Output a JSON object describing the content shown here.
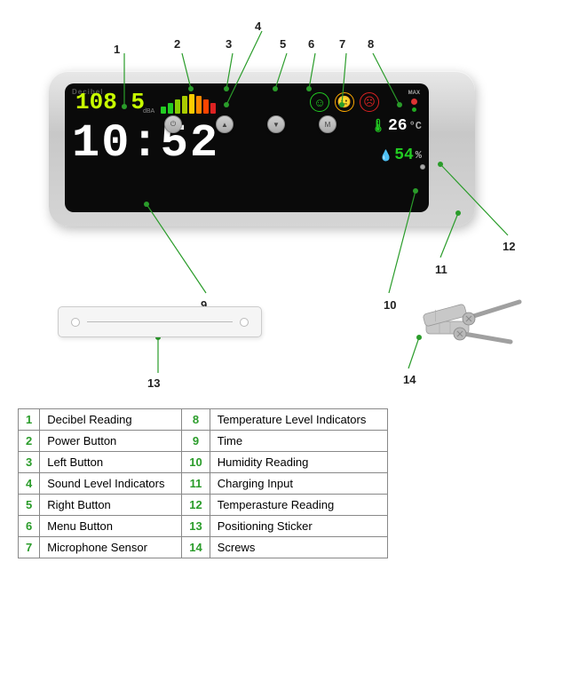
{
  "diagram": {
    "device": {
      "brand": "Decibel",
      "db_value": "108.5",
      "dba_label": "dBA",
      "time_value": "10:52",
      "temp_value": "26",
      "temp_unit": "°C",
      "humidity_value": "54",
      "humidity_unit": "%"
    },
    "callouts": [
      {
        "num": "1",
        "label": "Decibel Reading"
      },
      {
        "num": "2",
        "label": "Power Button"
      },
      {
        "num": "3",
        "label": "Left Button"
      },
      {
        "num": "4",
        "label": "Sound Level Indicators"
      },
      {
        "num": "5",
        "label": "Right Button"
      },
      {
        "num": "6",
        "label": "Menu Button"
      },
      {
        "num": "7",
        "label": "Microphone Sensor"
      },
      {
        "num": "8",
        "label": "Temperature Level Indicators"
      },
      {
        "num": "9",
        "label": "Time"
      },
      {
        "num": "10",
        "label": "Humidity Reading"
      },
      {
        "num": "11",
        "label": "Charging Input"
      },
      {
        "num": "12",
        "label": "Temperasture Reading"
      },
      {
        "num": "13",
        "label": "Positioning Sticker"
      },
      {
        "num": "14",
        "label": "Screws"
      }
    ]
  },
  "table": {
    "rows": [
      {
        "left_num": "1",
        "left_label": "Decibel Reading",
        "right_num": "8",
        "right_label": "Temperature Level Indicators"
      },
      {
        "left_num": "2",
        "left_label": "Power Button",
        "right_num": "9",
        "right_label": "Time"
      },
      {
        "left_num": "3",
        "left_label": "Left Button",
        "right_num": "10",
        "right_label": "Humidity Reading"
      },
      {
        "left_num": "4",
        "left_label": "Sound Level Indicators",
        "right_num": "11",
        "right_label": "Charging Input"
      },
      {
        "left_num": "5",
        "left_label": "Right Button",
        "right_num": "12",
        "right_label": "Temperasture Reading"
      },
      {
        "left_num": "6",
        "left_label": "Menu Button",
        "right_num": "13",
        "right_label": "Positioning Sticker"
      },
      {
        "left_num": "7",
        "left_label": "Microphone Sensor",
        "right_num": "14",
        "right_label": "Screws"
      }
    ]
  }
}
